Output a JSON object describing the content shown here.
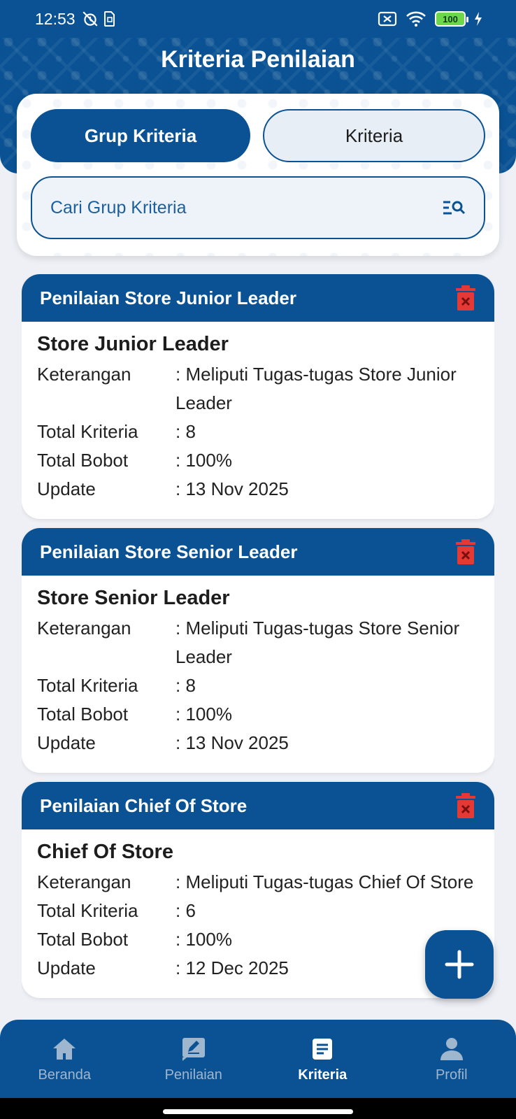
{
  "status_bar": {
    "time": "12:53",
    "battery": "100",
    "icons": [
      "alarm-off-icon",
      "sim-icon",
      "no-sim-icon",
      "wifi-icon",
      "battery-icon",
      "charging-icon"
    ]
  },
  "header": {
    "title": "Kriteria Penilaian"
  },
  "tabs": [
    {
      "label": "Grup Kriteria",
      "active": true
    },
    {
      "label": "Kriteria",
      "active": false
    }
  ],
  "search": {
    "placeholder": "Cari Grup Kriteria",
    "value": ""
  },
  "labels": {
    "keterangan": "Keterangan",
    "total_kriteria": "Total Kriteria",
    "total_bobot": "Total Bobot",
    "update": "Update"
  },
  "cards": [
    {
      "header": "Penilaian Store Junior Leader",
      "name": "Store Junior Leader",
      "keterangan": ": Meliputi Tugas-tugas Store Junior Leader",
      "total_kriteria": ": 8",
      "total_bobot": ": 100%",
      "update": ": 13 Nov 2025"
    },
    {
      "header": "Penilaian Store Senior Leader",
      "name": "Store Senior Leader",
      "keterangan": ": Meliputi Tugas-tugas Store Senior Leader",
      "total_kriteria": ": 8",
      "total_bobot": ": 100%",
      "update": ": 13 Nov 2025"
    },
    {
      "header": "Penilaian Chief Of Store",
      "name": "Chief Of Store",
      "keterangan": ": Meliputi Tugas-tugas Chief Of Store",
      "total_kriteria": ": 6",
      "total_bobot": ": 100%",
      "update": ": 12 Dec 2025"
    }
  ],
  "bottom_nav": [
    {
      "label": "Beranda",
      "icon": "home-icon",
      "active": false
    },
    {
      "label": "Penilaian",
      "icon": "edit-icon",
      "active": false
    },
    {
      "label": "Kriteria",
      "icon": "list-icon",
      "active": true
    },
    {
      "label": "Profil",
      "icon": "person-icon",
      "active": false
    }
  ],
  "colors": {
    "primary": "#0a5293",
    "background": "#eef0f6",
    "delete": "#e53935"
  }
}
